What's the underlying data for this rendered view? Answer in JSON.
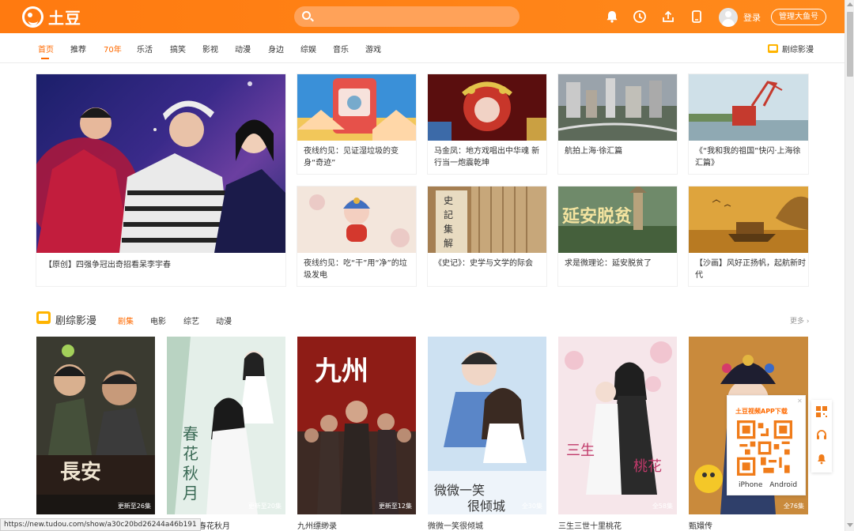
{
  "header": {
    "logo_text": "土豆",
    "search_placeholder": "",
    "login": "登录",
    "manage": "管理大鱼号",
    "icons": [
      "bell-icon",
      "history-icon",
      "upload-icon",
      "phone-icon"
    ]
  },
  "nav": {
    "items": [
      "首页",
      "推荐",
      "70年",
      "乐活",
      "搞笑",
      "影视",
      "动漫",
      "身边",
      "综娱",
      "音乐",
      "游戏"
    ],
    "right": "剧综影漫"
  },
  "featured": {
    "big_title": "【原创】四强争冠出奇招看呆李宇春",
    "cards": [
      "夜线约见：见证湿垃圾的变身“奇迹”",
      "马金凤：地方戏唱出中华魂 新行当一炮震乾坤",
      "航拍上海·徐汇篇",
      "《“我和我的祖国”快闪·上海徐汇篇》",
      "夜线约见：吃“干”用“净”的垃圾发电",
      "《史记》：史学与文学的际会",
      "求是微理论：延安脱贫了",
      "【沙画】风好正扬帆，起航新时代"
    ]
  },
  "section": {
    "title": "剧综影漫",
    "tabs": [
      "剧集",
      "电影",
      "综艺",
      "动漫"
    ],
    "more": "更多 ›",
    "posters": [
      {
        "title": "",
        "badge": "更新至26集"
      },
      {
        "title": "鬓一部之春花秋月",
        "badge": "更新至20集"
      },
      {
        "title": "九州缥缈录",
        "badge": "更新至12集"
      },
      {
        "title": "微微一笑很倾城",
        "badge": "全30集"
      },
      {
        "title": "三生三世十里桃花",
        "badge": "全58集"
      },
      {
        "title": "甄嬛传",
        "badge": "全76集"
      }
    ]
  },
  "qr_popup": {
    "title": "土豆视频APP下载",
    "close": "✕",
    "platforms": "iPhone Android"
  },
  "statusbar": "https://new.tudou.com/show/a30c20bd26244a46b191",
  "colors": {
    "brand": "#ff7a10",
    "accent": "#ff6a00",
    "tv_icon": "#ffb400"
  }
}
